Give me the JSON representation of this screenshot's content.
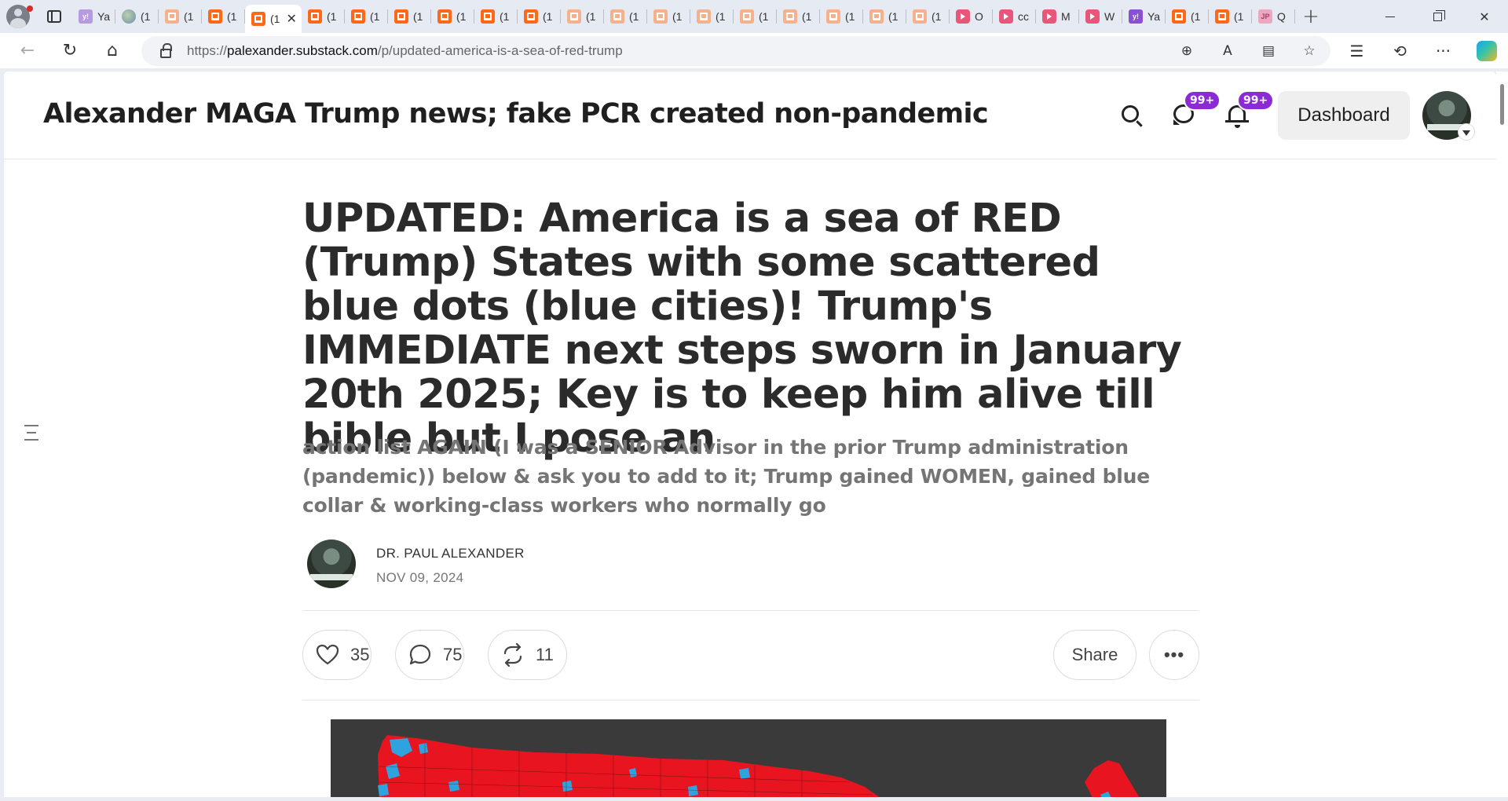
{
  "browser": {
    "tabs": [
      {
        "icon": "yahoo-favicon",
        "label": "Ya",
        "style": "fav-yahoo-faded"
      },
      {
        "icon": "globe-favicon",
        "label": "(1",
        "style": "fav-globe"
      },
      {
        "icon": "substack-favicon",
        "label": "(1",
        "style": "fav-substack-faded"
      },
      {
        "icon": "substack-favicon",
        "label": "(1",
        "style": "fav-substack"
      },
      {
        "icon": "substack-favicon",
        "label": "(1",
        "style": "active"
      },
      {
        "icon": "substack-favicon",
        "label": "(1",
        "style": "fav-substack"
      },
      {
        "icon": "substack-favicon",
        "label": "(1",
        "style": "fav-substack"
      },
      {
        "icon": "substack-favicon",
        "label": "(1",
        "style": "fav-substack"
      },
      {
        "icon": "substack-favicon",
        "label": "(1",
        "style": "fav-substack"
      },
      {
        "icon": "substack-favicon",
        "label": "(1",
        "style": "fav-substack"
      },
      {
        "icon": "substack-favicon",
        "label": "(1",
        "style": "fav-substack"
      },
      {
        "icon": "substack-favicon",
        "label": "(1",
        "style": "fav-substack-faded"
      },
      {
        "icon": "substack-favicon",
        "label": "(1",
        "style": "fav-substack-faded"
      },
      {
        "icon": "substack-favicon",
        "label": "(1",
        "style": "fav-substack-faded"
      },
      {
        "icon": "substack-favicon",
        "label": "(1",
        "style": "fav-substack-faded"
      },
      {
        "icon": "substack-favicon",
        "label": "(1",
        "style": "fav-substack-faded"
      },
      {
        "icon": "substack-favicon",
        "label": "(1",
        "style": "fav-substack-faded"
      },
      {
        "icon": "substack-favicon",
        "label": "(1",
        "style": "fav-substack-faded"
      },
      {
        "icon": "substack-favicon",
        "label": "(1",
        "style": "fav-substack-faded"
      },
      {
        "icon": "substack-favicon",
        "label": "(1",
        "style": "fav-substack-faded"
      },
      {
        "icon": "youtube-favicon",
        "label": "O",
        "style": "fav-youtube"
      },
      {
        "icon": "youtube-favicon",
        "label": "cc",
        "style": "fav-youtube"
      },
      {
        "icon": "youtube-favicon",
        "label": "M",
        "style": "fav-youtube"
      },
      {
        "icon": "youtube-favicon",
        "label": "W",
        "style": "fav-youtube"
      },
      {
        "icon": "yahoo-favicon",
        "label": "Ya",
        "style": "fav-yahoo"
      },
      {
        "icon": "substack-favicon",
        "label": "(1",
        "style": "fav-substack"
      },
      {
        "icon": "substack-favicon",
        "label": "(1",
        "style": "fav-substack"
      },
      {
        "icon": "jp-favicon",
        "label": "Q",
        "style": "fav-jp"
      }
    ],
    "yahoo_glyph": "y!",
    "jp_glyph": "JP",
    "close_glyph": "✕",
    "new_tab_glyph": "+",
    "url": {
      "scheme": "https://",
      "host": "palexander.substack.com",
      "path": "/p/updated-america-is-a-sea-of-red-trump"
    },
    "nav_glyphs": {
      "back": "←",
      "reload": "↻",
      "home": "⌂"
    },
    "url_action_glyphs": {
      "zoom": "⊕",
      "read_aloud": "A",
      "immersive": "▤",
      "favorite": "☆"
    },
    "tool_glyphs": {
      "favorites": "☰",
      "history": "⟲",
      "more": "···"
    },
    "window_glyphs": {
      "close": "✕"
    }
  },
  "site": {
    "publication_title": "Alexander MAGA Trump news; fake PCR created non-pandemic",
    "messages_badge": "99+",
    "notifications_badge": "99+",
    "dashboard_label": "Dashboard"
  },
  "post": {
    "title": "UPDATED: America is a sea of RED (Trump) States with some scattered blue dots (blue cities)! Trump's IMMEDIATE next steps sworn in January 20th 2025; Key is to keep him alive till bible but I pose an",
    "subtitle": "action list AGAIN (I was a SENIOR Advisor in the prior Trump administration (pandemic)) below & ask you to add to it; Trump gained WOMEN, gained blue collar & working-class workers who normally go",
    "author": "DR. PAUL ALEXANDER",
    "date": "NOV 09, 2024",
    "likes": "35",
    "comments": "75",
    "restacks": "11",
    "share_label": "Share",
    "more_glyph": "•••"
  },
  "colors": {
    "accent_badge": "#8c2bd6",
    "substack_orange": "#ff6719",
    "map_red": "#e8141f",
    "map_blue": "#2fa3e0",
    "map_background": "#3a3a3a"
  }
}
